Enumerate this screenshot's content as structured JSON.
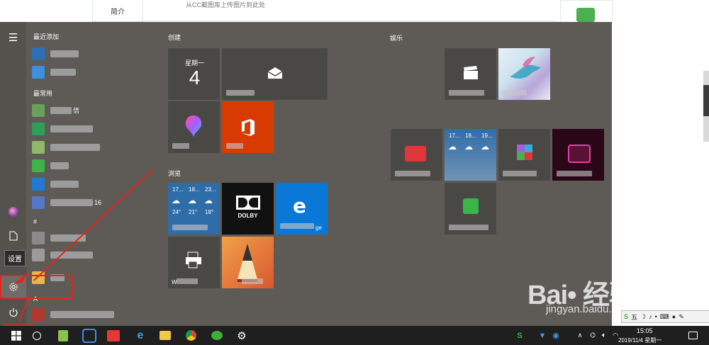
{
  "background": {
    "tab_label": "简介",
    "caption": "从CC截图库上传图片到此处"
  },
  "rail": {
    "tooltip": "设置"
  },
  "applist": {
    "recent_header": "最近添加",
    "common_header": "最常用",
    "hash_header": "#",
    "a_header": "A",
    "visible_fragments": [
      "信",
      "16"
    ],
    "chevron": "⌄"
  },
  "tiles": {
    "create_header": "创建",
    "browse_header": "浏览",
    "play_header": "娱乐",
    "calendar_day": "星期一",
    "calendar_num": "4",
    "weather_dates": [
      "17...",
      "18...",
      "23..."
    ],
    "weather_temps": [
      "24°",
      "21°",
      "18°"
    ],
    "weather2_dates": [
      "17...",
      "18...",
      "19..."
    ],
    "dolby_label": "DOLBY",
    "edge_suffix": "ge",
    "wps_prefix": "W"
  },
  "taskbar": {
    "time": "15:05",
    "date": "2019/11/4 星期一",
    "icons": [
      "start-icon",
      "search-icon",
      "notes-icon",
      "network-app-icon",
      "youdao-icon",
      "edge-icon",
      "explorer-icon",
      "chrome-icon",
      "wechat-icon",
      "settings-icon"
    ]
  },
  "ime": {
    "label": "五"
  },
  "watermark": {
    "logo": "Bai• 经验",
    "site": "jingyan.baidu.com"
  },
  "colors": {
    "start_bg": "#5e5b57",
    "tile_gray": "#4a4845",
    "office_orange": "#d83b01",
    "edge_blue": "#0a78d7",
    "weather_blue": "#2f6da8",
    "annotation_red": "#e0261e",
    "taskbar": "#1f1f1f"
  }
}
